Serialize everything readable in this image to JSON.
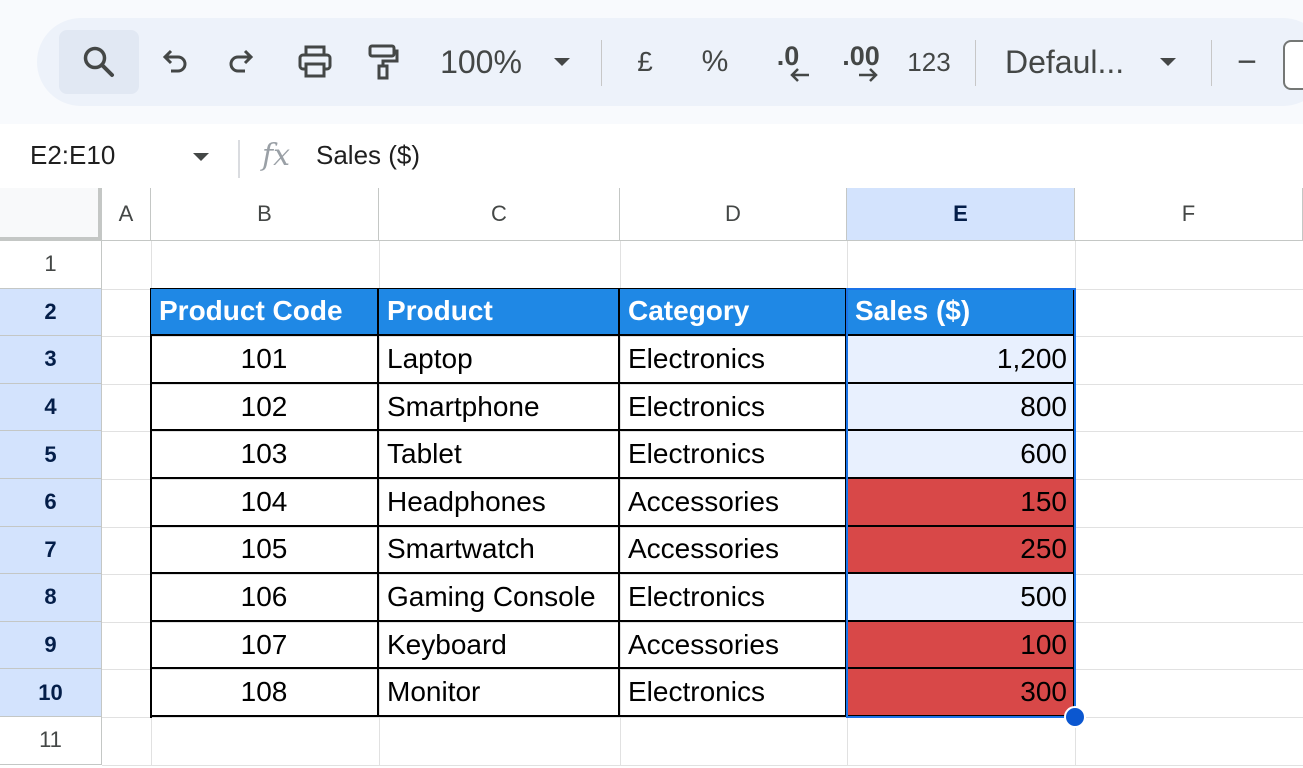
{
  "toolbar": {
    "zoom": "100%",
    "currency": "£",
    "percent": "%",
    "decrease_decimal": ".0",
    "increase_decimal": ".00",
    "number_format": "123",
    "font": "Defaul...",
    "font_size_minus": "−"
  },
  "formula_bar": {
    "name_box": "E2:E10",
    "fx": "fx",
    "formula": "Sales ($)"
  },
  "columns": [
    "A",
    "B",
    "C",
    "D",
    "E",
    "F"
  ],
  "rows": [
    "1",
    "2",
    "3",
    "4",
    "5",
    "6",
    "7",
    "8",
    "9",
    "10",
    "11"
  ],
  "table": {
    "headers": [
      "Product Code",
      "Product",
      "Category",
      "Sales ($)"
    ],
    "rows": [
      {
        "code": "101",
        "product": "Laptop",
        "category": "Electronics",
        "sales": "1,200",
        "highlight": false
      },
      {
        "code": "102",
        "product": "Smartphone",
        "category": "Electronics",
        "sales": "800",
        "highlight": false
      },
      {
        "code": "103",
        "product": "Tablet",
        "category": "Electronics",
        "sales": "600",
        "highlight": false
      },
      {
        "code": "104",
        "product": "Headphones",
        "category": "Accessories",
        "sales": "150",
        "highlight": true
      },
      {
        "code": "105",
        "product": "Smartwatch",
        "category": "Accessories",
        "sales": "250",
        "highlight": true
      },
      {
        "code": "106",
        "product": "Gaming Console",
        "category": "Electronics",
        "sales": "500",
        "highlight": false
      },
      {
        "code": "107",
        "product": "Keyboard",
        "category": "Accessories",
        "sales": "100",
        "highlight": true
      },
      {
        "code": "108",
        "product": "Monitor",
        "category": "Electronics",
        "sales": "300",
        "highlight": true
      }
    ]
  },
  "colors": {
    "header_fill": "#1f88e5",
    "selection_fill": "#e8f0fe",
    "conditional_fill": "#d84848",
    "selection_border": "#1a73e8"
  }
}
